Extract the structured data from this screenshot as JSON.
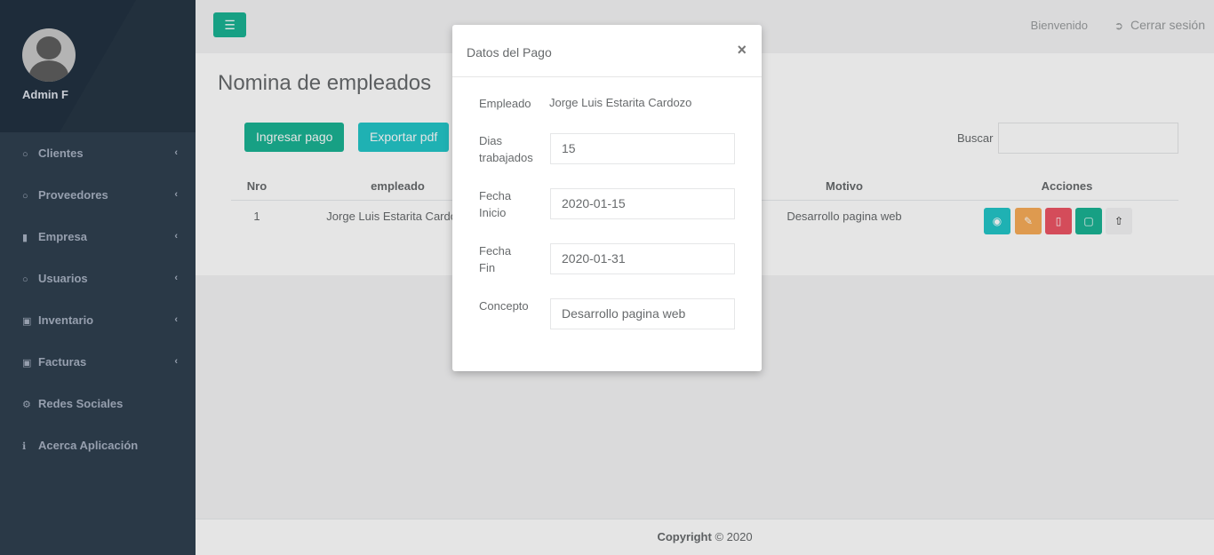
{
  "sidebar": {
    "profile_name": "Admin F",
    "items": [
      {
        "label": "Clientes",
        "icon": "user-icon",
        "glyph": "⚀",
        "has_chevron": true
      },
      {
        "label": "Proveedores",
        "icon": "user-icon",
        "glyph": "⚀",
        "has_chevron": true
      },
      {
        "label": "Empresa",
        "icon": "building-icon",
        "glyph": "▮",
        "has_chevron": true
      },
      {
        "label": "Usuarios",
        "icon": "user-icon",
        "glyph": "⚀",
        "has_chevron": true
      },
      {
        "label": "Inventario",
        "icon": "cart-icon",
        "glyph": "⬛",
        "has_chevron": true
      },
      {
        "label": "Facturas",
        "icon": "cart-icon",
        "glyph": "⬛",
        "has_chevron": true
      },
      {
        "label": "Redes Sociales",
        "icon": "gear-icon",
        "glyph": "⚙",
        "has_chevron": false
      },
      {
        "label": "Acerca Aplicación",
        "icon": "info-icon",
        "glyph": "ℹ",
        "has_chevron": false
      }
    ]
  },
  "topbar": {
    "welcome": "Bienvenido",
    "logout": "Cerrar sesión"
  },
  "main": {
    "title": "Nomina de empleados",
    "ingresar_label": "Ingresar pago",
    "exportar_label": "Exportar pdf",
    "search_label": "Buscar",
    "search_value": "",
    "table": {
      "headers": [
        "Nro",
        "empleado",
        "",
        "Motivo",
        "Acciones"
      ],
      "rows": [
        {
          "nro": "1",
          "empleado": "Jorge Luis Estarita Cardozo",
          "motivo": "Desarrollo pagina web"
        }
      ]
    }
  },
  "modal": {
    "title": "Datos del Pago",
    "close": "×",
    "empleado_label": "Empleado",
    "empleado_value": "Jorge Luis Estarita Cardozo",
    "dias_label": "Dias trabajados",
    "dias_value": "15",
    "inicio_label": "Fecha Inicio",
    "inicio_value": "2020-01-15",
    "fin_label": "Fecha Fin",
    "fin_value": "2020-01-31",
    "concepto_label": "Concepto",
    "concepto_value": "Desarrollo pagina web"
  },
  "footer": {
    "bold": "Copyright",
    "rest": " © 2020"
  },
  "colors": {
    "sidebar": "#2f4050",
    "primary": "#1ab394",
    "info": "#23c6c8",
    "warning": "#f8ac59",
    "danger": "#ed5565"
  }
}
